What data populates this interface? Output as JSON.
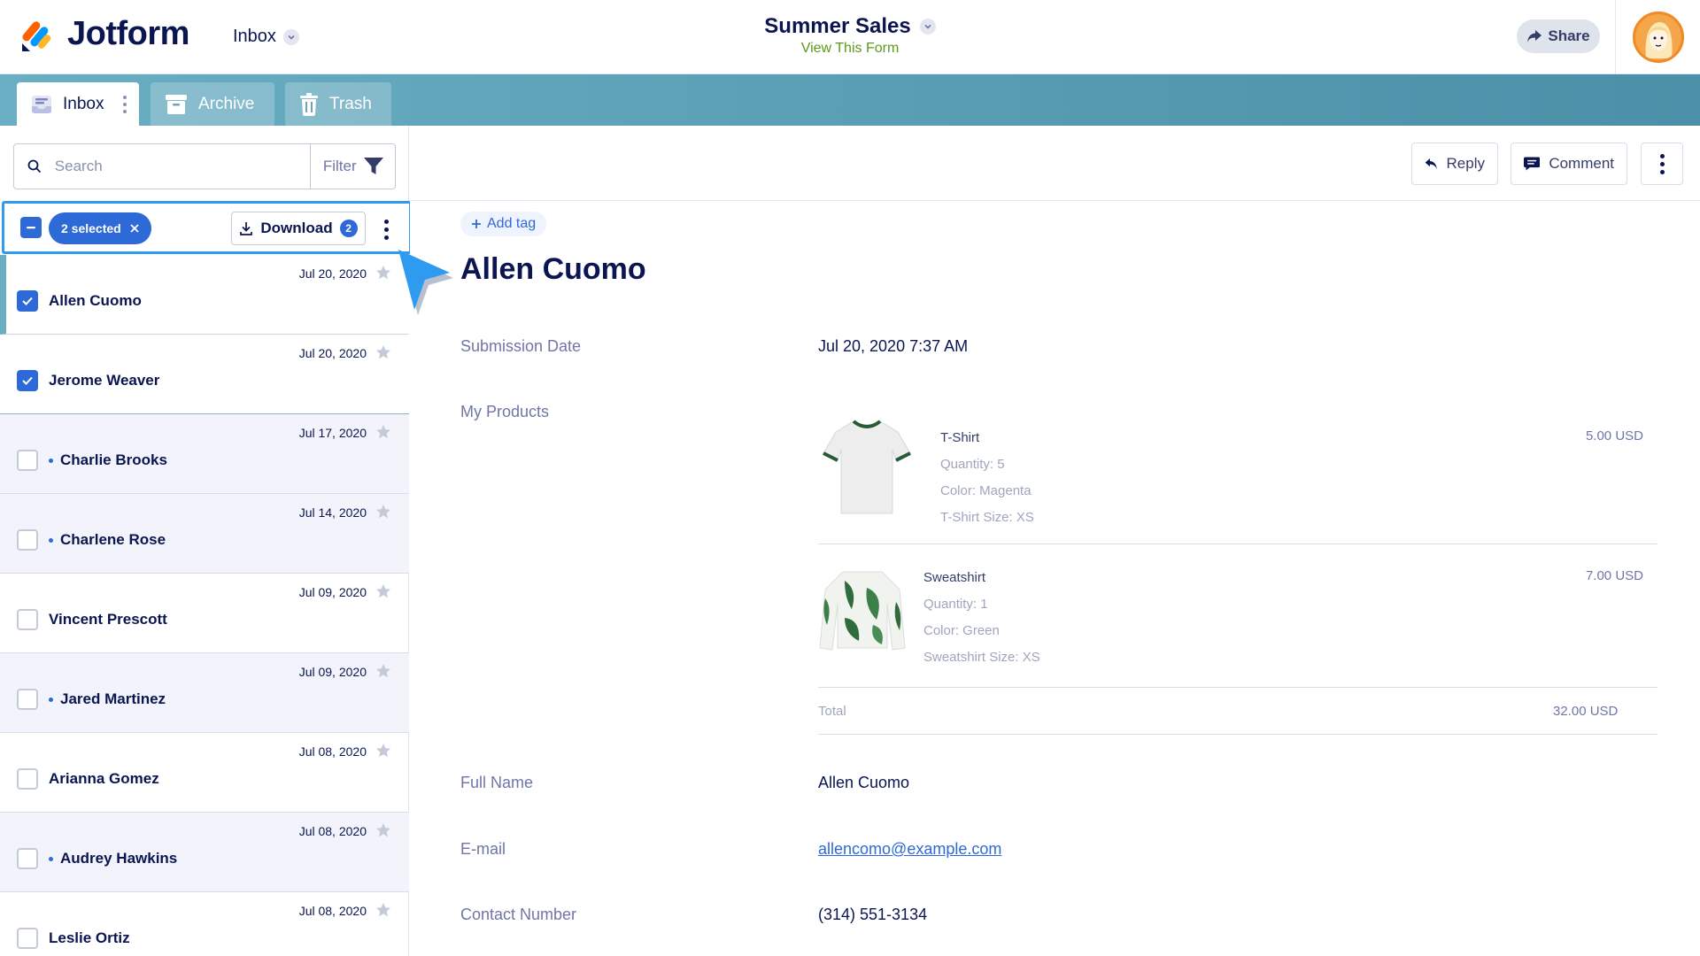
{
  "header": {
    "brand": "Jotform",
    "inbox_switch": "Inbox",
    "form_title": "Summer Sales",
    "form_link": "View This Form",
    "share_label": "Share"
  },
  "tabs": [
    {
      "label": "Inbox",
      "active": true
    },
    {
      "label": "Archive",
      "active": false
    },
    {
      "label": "Trash",
      "active": false
    }
  ],
  "search": {
    "placeholder": "Search",
    "value": "",
    "filter_label": "Filter"
  },
  "selection": {
    "chip_label": "2 selected",
    "download_label": "Download",
    "download_count": "2"
  },
  "submissions": [
    {
      "name": "Allen Cuomo",
      "date": "Jul 20, 2020",
      "checked": true,
      "unread": false
    },
    {
      "name": "Jerome Weaver",
      "date": "Jul 20, 2020",
      "checked": true,
      "unread": false
    },
    {
      "name": "Charlie Brooks",
      "date": "Jul 17, 2020",
      "checked": false,
      "unread": true
    },
    {
      "name": "Charlene Rose",
      "date": "Jul 14, 2020",
      "checked": false,
      "unread": true
    },
    {
      "name": "Vincent Prescott",
      "date": "Jul 09, 2020",
      "checked": false,
      "unread": false
    },
    {
      "name": "Jared Martinez",
      "date": "Jul 09, 2020",
      "checked": false,
      "unread": true
    },
    {
      "name": "Arianna Gomez",
      "date": "Jul 08, 2020",
      "checked": false,
      "unread": false
    },
    {
      "name": "Audrey Hawkins",
      "date": "Jul 08, 2020",
      "checked": false,
      "unread": true
    },
    {
      "name": "Leslie Ortiz",
      "date": "Jul 08, 2020",
      "checked": false,
      "unread": false
    }
  ],
  "toolbar": {
    "reply_label": "Reply",
    "comment_label": "Comment"
  },
  "detail": {
    "add_tag_label": "Add tag",
    "name": "Allen Cuomo",
    "submission_date_label": "Submission Date",
    "submission_date_value": "Jul 20, 2020 7:37 AM",
    "products_label": "My Products",
    "products": [
      {
        "name": "T-Shirt",
        "quantity": "Quantity: 5",
        "color": "Color: Magenta",
        "size": "T-Shirt Size: XS",
        "price": "5.00 USD"
      },
      {
        "name": "Sweatshirt",
        "quantity": "Quantity: 1",
        "color": "Color: Green",
        "size": "Sweatshirt Size: XS",
        "price": "7.00 USD"
      }
    ],
    "total_label": "Total",
    "total_value": "32.00 USD",
    "full_name_label": "Full Name",
    "full_name_value": "Allen Cuomo",
    "email_label": "E-mail",
    "email_value": "allencomo@example.com",
    "contact_label": "Contact Number",
    "contact_value": "(314) 551-3134"
  },
  "colors": {
    "navy": "#0a1551",
    "accent_blue": "#2e69d8",
    "selection_border": "#2f9bf0",
    "link_green": "#5a9a18",
    "tabbar_teal": "#5a9fb6",
    "logo_orange": "#ff6100",
    "logo_blue": "#0099ff",
    "logo_yellow": "#ffb629"
  }
}
